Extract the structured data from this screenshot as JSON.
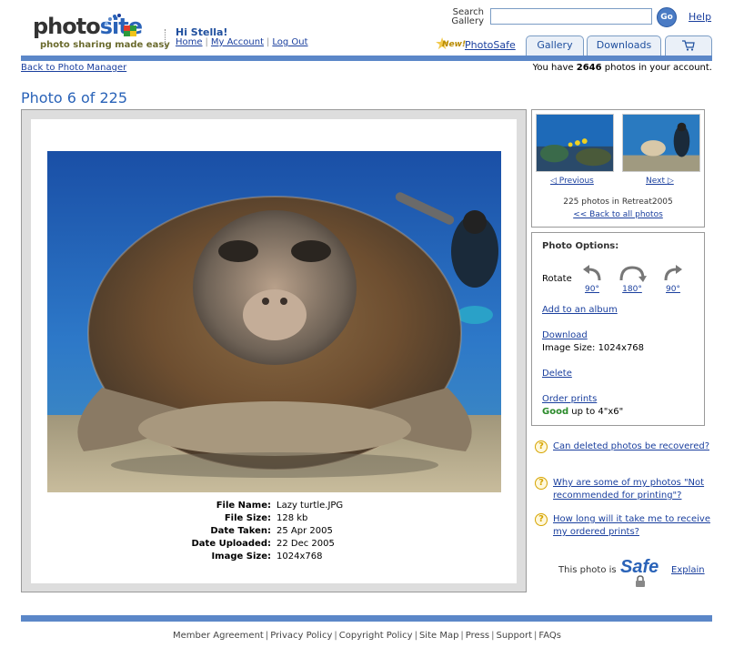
{
  "brand": {
    "logo_text_main": "photo",
    "logo_text_site": "site",
    "tagline": "photo sharing made easy"
  },
  "header": {
    "greeting": "Hi Stella!",
    "links": [
      {
        "label": "Home"
      },
      {
        "label": "My Account"
      },
      {
        "label": "Log Out"
      }
    ],
    "search_label": "Search Gallery",
    "search_value": "",
    "go_label": "Go",
    "help_label": "Help",
    "new_badge": "New!",
    "photosafe_label": "PhotoSafe",
    "tabs": [
      {
        "label": "Gallery"
      },
      {
        "label": "Downloads"
      },
      {
        "label": "",
        "icon": "cart-icon"
      }
    ]
  },
  "subbar": {
    "back_label": "Back to Photo Manager",
    "count_prefix": "You have",
    "count_value": "2646",
    "count_suffix": "photos in your account."
  },
  "page_title": "Photo 6 of 225",
  "photo": {
    "description_icon": "sea-turtle-photo",
    "meta": [
      {
        "key": "File Name:",
        "value": "Lazy turtle.JPG"
      },
      {
        "key": "File Size:",
        "value": "128 kb"
      },
      {
        "key": "Date Taken:",
        "value": "25 Apr 2005"
      },
      {
        "key": "Date Uploaded:",
        "value": "22 Dec 2005"
      },
      {
        "key": "Image Size:",
        "value": "1024x768"
      }
    ]
  },
  "navigation": {
    "prev_label": "Previous",
    "next_label": "Next",
    "count_text": "225 photos in Retreat2005",
    "back_all_label": "<< Back to all photos"
  },
  "options": {
    "title": "Photo Options:",
    "rotate_label": "Rotate",
    "rotate_left": "90°",
    "rotate_180": "180°",
    "rotate_right": "90°",
    "add_album": "Add to an album",
    "download": "Download",
    "image_size": "Image Size: 1024x768",
    "delete": "Delete",
    "order_prints": "Order prints",
    "print_quality": "Good",
    "print_quality_suffix": "up to 4\"x6\""
  },
  "faq": [
    {
      "question": "Can deleted photos be recovered?"
    },
    {
      "question": "Why are some of my photos \"Not recommended for printing\"?"
    },
    {
      "question": "How long will it take me to receive my ordered prints?"
    }
  ],
  "safe": {
    "text": "This photo is",
    "logo_word": "Safe",
    "explain": "Explain"
  },
  "footer": {
    "links": [
      {
        "label": "Member Agreement"
      },
      {
        "label": "Privacy Policy"
      },
      {
        "label": "Copyright Policy"
      },
      {
        "label": "Site Map"
      },
      {
        "label": "Press"
      },
      {
        "label": "Support"
      },
      {
        "label": "FAQs"
      }
    ]
  },
  "colors": {
    "accent_blue": "#5b87c8",
    "link_blue": "#1a3f9e",
    "title_blue": "#2a63b8",
    "good_green": "#2a8a2a"
  }
}
